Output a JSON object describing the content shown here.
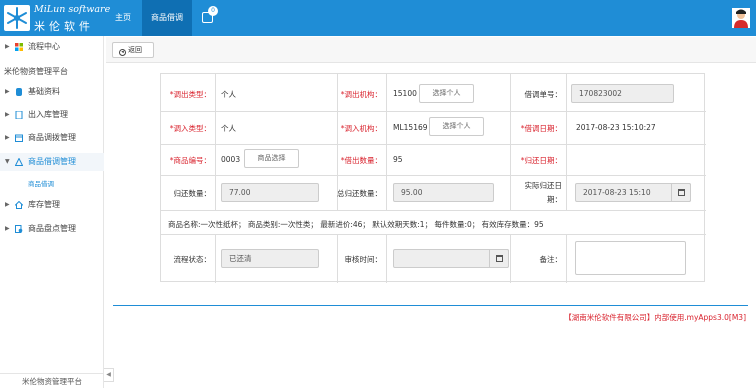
{
  "header": {
    "brand_en": "MiLun software",
    "brand_cn": "米伦软件",
    "nav": {
      "home": "主页",
      "active": "商品借调"
    },
    "notify_count": "0"
  },
  "sidebar": {
    "top_item": "流程中心",
    "section_title": "米伦物资管理平台",
    "items": [
      "基础资料",
      "出入库管理",
      "商品调拨管理",
      "商品借调管理",
      "库存管理",
      "商品盘点管理"
    ],
    "sub_item": "商品借调",
    "footer": "米伦物资管理平台"
  },
  "toolbar": {
    "back_label": "返回"
  },
  "form": {
    "row1": {
      "out_type_label": "*调出类型：",
      "out_type_value": "个人",
      "out_org_label": "*调出机构：",
      "out_org_value": "15100",
      "out_org_btn": "选择个人",
      "doc_no_label": "借调单号：",
      "doc_no_value": "170823002"
    },
    "row2": {
      "in_type_label": "*调入类型：",
      "in_type_value": "个人",
      "in_org_label": "*调入机构：",
      "in_org_value": "ML15169",
      "in_org_btn": "选择个人",
      "date_label": "*借调日期：",
      "date_value": "2017-08-23 15:10:27"
    },
    "row3": {
      "goods_no_label": "*商品编号：",
      "goods_no_value": "0003",
      "goods_btn": "商品选择",
      "qty_label": "*借出数量：",
      "qty_value": "95",
      "return_date_label": "*归还日期："
    },
    "row4": {
      "return_qty_label": "归还数量：",
      "return_qty_value": "77.00",
      "total_return_label": "总归还数量：",
      "total_return_value": "95.00",
      "actual_return_label_1": "实际归还日",
      "actual_return_label_2": "期：",
      "actual_return_value": "2017-08-23 15:10"
    },
    "info_line": "商品名称:一次性纸杯； 商品类别:一次性类； 最新进价:46； 默认效期天数:1； 每件数量:0； 有效库存数量：95",
    "row6": {
      "status_label": "流程状态：",
      "status_value": "已还清",
      "audit_time_label": "审核时间：",
      "remark_label": "备注："
    }
  },
  "footer_note": "【湖南米伦软件有限公司】内部使用.myApps3.0[M3]",
  "colors": {
    "brand": "#1f8dd6",
    "required": "#d9232e"
  }
}
